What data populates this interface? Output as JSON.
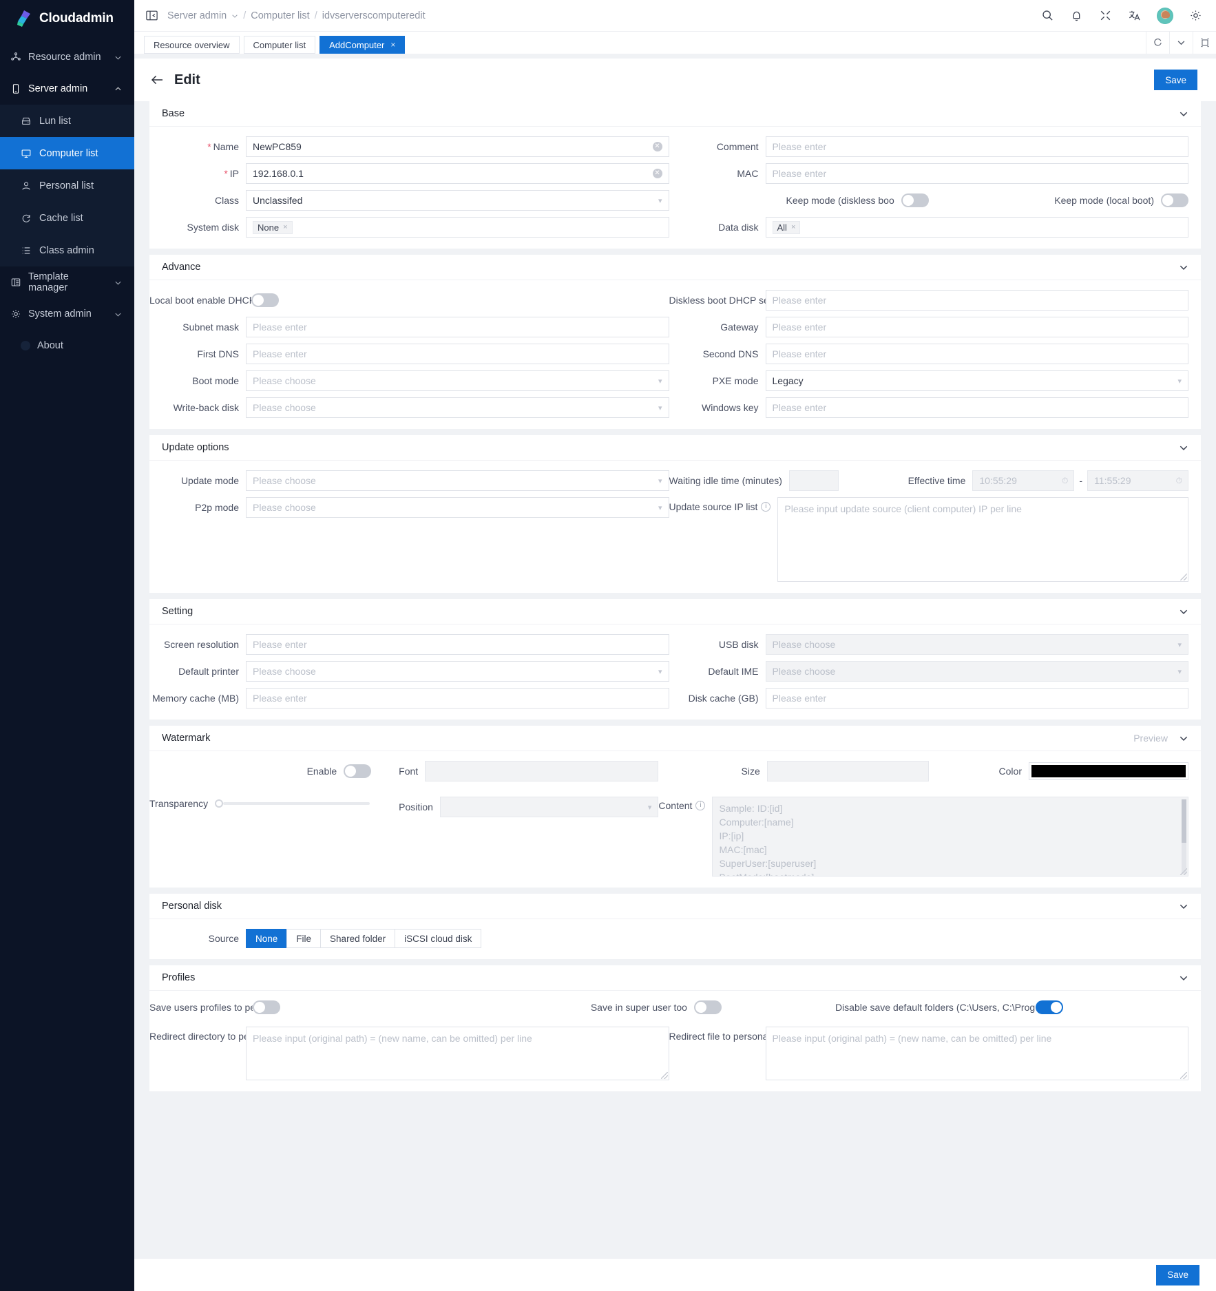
{
  "brand": {
    "name": "Cloudadmin"
  },
  "sidebar": {
    "items": [
      {
        "label": "Resource admin",
        "icon": "resource-icon",
        "caret": "chevron-down"
      },
      {
        "label": "Server admin",
        "icon": "server-icon",
        "caret": "chevron-up"
      }
    ],
    "sub_items": [
      {
        "label": "Lun list",
        "icon": "lun-icon",
        "active": false
      },
      {
        "label": "Computer list",
        "icon": "monitor-icon",
        "active": true
      },
      {
        "label": "Personal list",
        "icon": "user-icon",
        "active": false
      },
      {
        "label": "Cache list",
        "icon": "refresh-icon",
        "active": false
      },
      {
        "label": "Class admin",
        "icon": "list-icon",
        "active": false
      }
    ],
    "items2": [
      {
        "label": "Template manager",
        "icon": "template-icon",
        "caret": "chevron-down"
      },
      {
        "label": "System admin",
        "icon": "gear-icon",
        "caret": "chevron-down"
      }
    ],
    "about": {
      "label": "About"
    }
  },
  "topbar": {
    "breadcrumb": [
      "Server admin",
      "Computer list",
      "idvserverscomputeredit"
    ],
    "icons": [
      "search-icon",
      "bell-icon",
      "fullscreen-icon",
      "translate-icon",
      "avatar",
      "gear-icon"
    ]
  },
  "tabs": [
    {
      "label": "Resource overview",
      "active": false,
      "closable": false
    },
    {
      "label": "Computer list",
      "active": false,
      "closable": false
    },
    {
      "label": "AddComputer",
      "active": true,
      "closable": true,
      "close": "×"
    }
  ],
  "tabs_right_icons": [
    "reload-icon",
    "chevron-down-icon",
    "maximize-icon"
  ],
  "page": {
    "title": "Edit",
    "back": "back-arrow",
    "save_label": "Save",
    "footer_save_label": "Save"
  },
  "sections": {
    "base": {
      "title": "Base",
      "name_label": "Name",
      "name_value": "NewPC859",
      "comment_label": "Comment",
      "comment_placeholder": "Please enter",
      "ip_label": "IP",
      "ip_value": "192.168.0.1",
      "mac_label": "MAC",
      "mac_placeholder": "Please enter",
      "class_label": "Class",
      "class_value": "Unclassifed",
      "keep_diskless_label": "Keep mode (diskless boo",
      "keep_diskless_on": false,
      "keep_local_label": "Keep mode (local boot)",
      "keep_local_on": false,
      "system_disk_label": "System disk",
      "system_disk_tag": "None",
      "data_disk_label": "Data disk",
      "data_disk_tag": "All",
      "tag_close": "×"
    },
    "advance": {
      "title": "Advance",
      "local_dhcp_label": "Local boot enable DHCP",
      "local_dhcp_on": false,
      "diskless_dhcp_label": "Diskless boot DHCP serv",
      "diskless_dhcp_placeholder": "Please enter",
      "subnet_label": "Subnet mask",
      "subnet_placeholder": "Please enter",
      "gateway_label": "Gateway",
      "gateway_placeholder": "Please enter",
      "first_dns_label": "First DNS",
      "first_dns_placeholder": "Please enter",
      "second_dns_label": "Second DNS",
      "second_dns_placeholder": "Please enter",
      "boot_mode_label": "Boot mode",
      "boot_mode_placeholder": "Please choose",
      "pxe_mode_label": "PXE mode",
      "pxe_mode_value": "Legacy",
      "writeback_label": "Write-back disk",
      "writeback_placeholder": "Please choose",
      "winkey_label": "Windows key",
      "winkey_placeholder": "Please enter"
    },
    "update": {
      "title": "Update options",
      "update_mode_label": "Update mode",
      "update_mode_placeholder": "Please choose",
      "waiting_idle_label": "Waiting idle time (minutes)",
      "waiting_idle_value": "",
      "effective_time_label": "Effective time",
      "effective_time_from": "10:55:29",
      "effective_time_to": "11:55:29",
      "effective_time_sep": "-",
      "p2p_label": "P2p mode",
      "p2p_placeholder": "Please choose",
      "source_ip_label": "Update source IP list",
      "source_ip_placeholder": "Please input update source (client computer) IP per line"
    },
    "setting": {
      "title": "Setting",
      "screen_res_label": "Screen resolution",
      "screen_res_placeholder": "Please enter",
      "usb_disk_label": "USB disk",
      "usb_disk_placeholder": "Please choose",
      "default_printer_label": "Default printer",
      "default_printer_placeholder": "Please choose",
      "default_ime_label": "Default IME",
      "default_ime_placeholder": "Please choose",
      "mem_cache_label": "Memory cache (MB)",
      "mem_cache_placeholder": "Please enter",
      "disk_cache_label": "Disk cache (GB)",
      "disk_cache_placeholder": "Please enter"
    },
    "watermark": {
      "title": "Watermark",
      "preview_label": "Preview",
      "enable_label": "Enable",
      "enable_on": false,
      "font_label": "Font",
      "font_value": "",
      "size_label": "Size",
      "size_value": "",
      "color_label": "Color",
      "color_value": "#000000",
      "transparency_label": "Transparency",
      "position_label": "Position",
      "position_value": "",
      "content_label": "Content",
      "content_lines": [
        "Sample:  ID:[id]",
        "Computer:[name]",
        "IP:[ip]",
        "MAC:[mac]",
        "SuperUser:[superuser]",
        "BootMode:[bootmode]"
      ]
    },
    "personal_disk": {
      "title": "Personal disk",
      "source_label": "Source",
      "options": [
        "None",
        "File",
        "Shared folder",
        "iSCSI cloud disk"
      ],
      "selected": "None"
    },
    "profiles": {
      "title": "Profiles",
      "save_users_label": "Save users profiles to pe",
      "save_users_on": false,
      "save_super_label": "Save in super user too",
      "save_super_on": false,
      "disable_default_label": "Disable save default folders (C:\\Users, C:\\Program",
      "disable_default_on": true,
      "redirect_dir_label": "Redirect directory to per",
      "redirect_dir_placeholder": "Please input (original path) = (new name, can be omitted) per line",
      "redirect_file_label": "Redirect file to personal",
      "redirect_file_placeholder": "Please input (original path) = (new name, can be omitted) per line"
    }
  },
  "colors": {
    "accent": "#1271d4",
    "sidebar_bg": "#0c1426",
    "required": "#e8516a"
  }
}
